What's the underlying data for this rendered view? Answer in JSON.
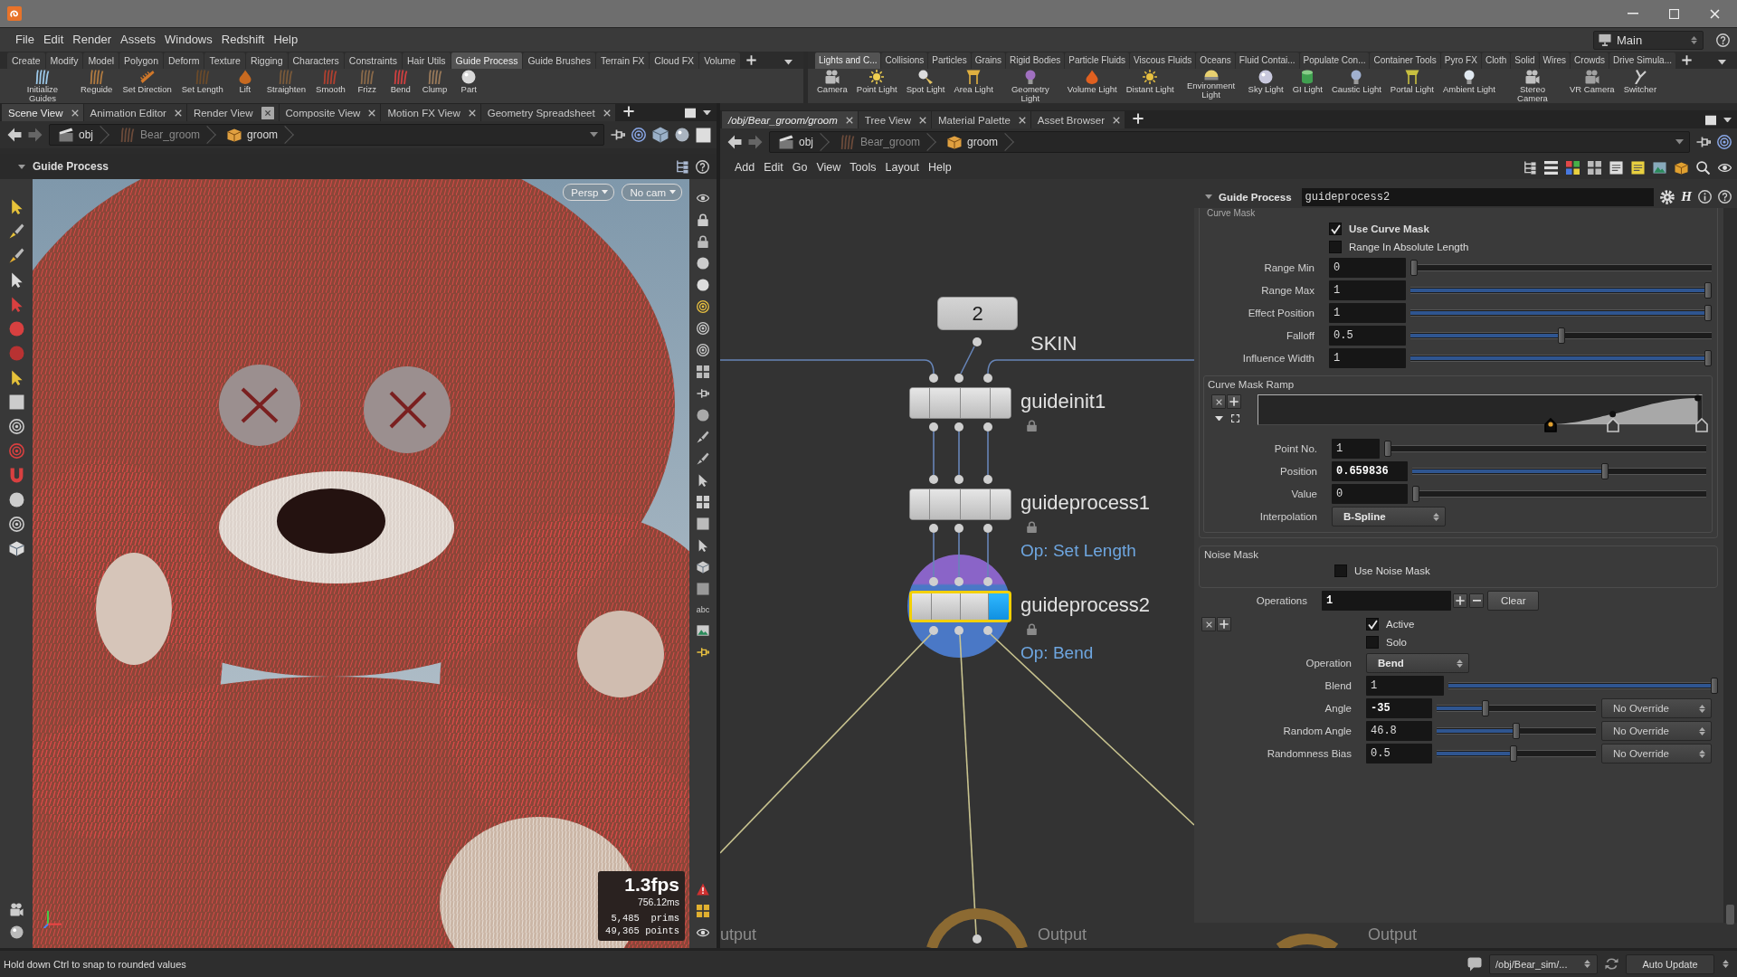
{
  "menu_bar": {
    "items": [
      "File",
      "Edit",
      "Render",
      "Assets",
      "Windows",
      "Redshift",
      "Help"
    ],
    "desktop": "Main"
  },
  "shelves": [
    {
      "tabs": [
        {
          "label": "Create",
          "selected": false
        },
        {
          "label": "Modify",
          "selected": false
        },
        {
          "label": "Model",
          "selected": false
        },
        {
          "label": "Polygon",
          "selected": false
        },
        {
          "label": "Deform",
          "selected": false
        },
        {
          "label": "Texture",
          "selected": false
        },
        {
          "label": "Rigging",
          "selected": false
        },
        {
          "label": "Characters",
          "selected": false
        },
        {
          "label": "Constraints",
          "selected": false
        },
        {
          "label": "Hair Utils",
          "selected": false
        },
        {
          "label": "Guide Process",
          "selected": true
        },
        {
          "label": "Guide Brushes",
          "selected": false
        },
        {
          "label": "Terrain FX",
          "selected": false
        },
        {
          "label": "Cloud FX",
          "selected": false
        },
        {
          "label": "Volume",
          "selected": false
        }
      ],
      "tools": [
        "Initialize Guides",
        "Reguide",
        "Set Direction",
        "Set Length",
        "Lift",
        "Straighten",
        "Smooth",
        "Frizz",
        "Bend",
        "Clump",
        "Part"
      ]
    },
    {
      "tabs": [
        {
          "label": "Lights and C...",
          "selected": true
        },
        {
          "label": "Collisions",
          "selected": false
        },
        {
          "label": "Particles",
          "selected": false
        },
        {
          "label": "Grains",
          "selected": false
        },
        {
          "label": "Rigid Bodies",
          "selected": false
        },
        {
          "label": "Particle Fluids",
          "selected": false
        },
        {
          "label": "Viscous Fluids",
          "selected": false
        },
        {
          "label": "Oceans",
          "selected": false
        },
        {
          "label": "Fluid Contai...",
          "selected": false
        },
        {
          "label": "Populate Con...",
          "selected": false
        },
        {
          "label": "Container Tools",
          "selected": false
        },
        {
          "label": "Pyro FX",
          "selected": false
        },
        {
          "label": "Cloth",
          "selected": false
        },
        {
          "label": "Solid",
          "selected": false
        },
        {
          "label": "Wires",
          "selected": false
        },
        {
          "label": "Crowds",
          "selected": false
        },
        {
          "label": "Drive Simula...",
          "selected": false
        }
      ],
      "tools": [
        "Camera",
        "Point Light",
        "Spot Light",
        "Area Light",
        "Geometry Light",
        "Volume Light",
        "Distant Light",
        "Environment Light",
        "Sky Light",
        "GI Light",
        "Caustic Light",
        "Portal Light",
        "Ambient Light",
        "Stereo Camera",
        "VR Camera",
        "Switcher"
      ]
    }
  ],
  "scene_view": {
    "tabs": [
      {
        "label": "Scene View",
        "selected": true,
        "close_hover": false
      },
      {
        "label": "Animation Editor",
        "selected": false,
        "close_hover": false
      },
      {
        "label": "Render View",
        "selected": false,
        "close_hover": true
      },
      {
        "label": "Composite View",
        "selected": false,
        "close_hover": false
      },
      {
        "label": "Motion FX View",
        "selected": false,
        "close_hover": false
      },
      {
        "label": "Geometry Spreadsheet",
        "selected": false,
        "close_hover": false
      }
    ],
    "path": [
      {
        "label": "obj",
        "dimmed": false
      },
      {
        "label": "Bear_groom",
        "dimmed": true
      },
      {
        "label": "groom",
        "dimmed": false
      }
    ],
    "header": "Guide Process",
    "camera_menus": [
      "Persp",
      "No cam"
    ],
    "fps": "1.3fps",
    "frame_time": "756.12ms",
    "stats": [
      "5,485  prims",
      "49,365 points"
    ],
    "toolbar_label": "abc"
  },
  "network_view": {
    "tabs": [
      {
        "label": "/obj/Bear_groom/groom",
        "selected": true,
        "close_hover": false
      },
      {
        "label": "Tree View",
        "selected": false,
        "close_hover": false
      },
      {
        "label": "Material Palette",
        "selected": false,
        "close_hover": false
      },
      {
        "label": "Asset Browser",
        "selected": false,
        "close_hover": false
      }
    ],
    "path": [
      {
        "label": "obj",
        "dimmed": false
      },
      {
        "label": "Bear_groom",
        "dimmed": true
      },
      {
        "label": "groom",
        "dimmed": false
      }
    ],
    "menu": [
      "Add",
      "Edit",
      "Go",
      "View",
      "Tools",
      "Layout",
      "Help"
    ],
    "nodes": [
      {
        "kind": "tag",
        "label": "2",
        "name": "SKIN",
        "selected": false
      },
      {
        "kind": "node",
        "name": "guideinit1",
        "locked": true,
        "selected": false,
        "display": false
      },
      {
        "kind": "node",
        "name": "guideprocess1",
        "comment": "Op: Set Length",
        "locked": true,
        "selected": false,
        "display": false
      },
      {
        "kind": "node",
        "name": "guideprocess2",
        "comment": "Op: Bend",
        "locked": true,
        "selected": true,
        "display": true
      },
      {
        "kind": "output",
        "name": "utput",
        "selected": false
      },
      {
        "kind": "output",
        "name": "Output",
        "selected": false
      },
      {
        "kind": "output",
        "name": "Output",
        "selected": false
      }
    ]
  },
  "parameters": {
    "title": "Guide Process",
    "node_name": "guideprocess2",
    "asset_menu": "H",
    "folder_label": "Curve Mask",
    "curve_mask": [
      {
        "kind": "checkbox",
        "label": "Use Curve Mask",
        "checked": true,
        "modified": true
      },
      {
        "kind": "checkbox",
        "label": "Range In Absolute Length",
        "checked": false,
        "modified": false
      },
      {
        "kind": "slider",
        "label": "Range Min",
        "value": "0",
        "level": 0,
        "modified": false
      },
      {
        "kind": "slider",
        "label": "Range Max",
        "value": "1",
        "level": 1,
        "modified": false
      },
      {
        "kind": "slider",
        "label": "Effect Position",
        "value": "1",
        "level": 1,
        "modified": false
      },
      {
        "kind": "slider",
        "label": "Falloff",
        "value": "0.5",
        "level": 0.5,
        "modified": false
      },
      {
        "kind": "slider",
        "label": "Influence Width",
        "value": "1",
        "level": 1,
        "modified": false
      }
    ],
    "ramp": {
      "label": "Curve Mask Ramp",
      "points": [
        {
          "level": 0.66,
          "selected": true
        },
        {
          "level": 0.8,
          "selected": false
        },
        {
          "level": 1,
          "selected": false
        }
      ],
      "rows": [
        {
          "kind": "int_slider",
          "label": "Point No.",
          "value": "1",
          "level": 0,
          "modified": false
        },
        {
          "kind": "slider",
          "label": "Position",
          "value": "0.659836",
          "level": 0.66,
          "modified": true
        },
        {
          "kind": "slider",
          "label": "Value",
          "value": "0",
          "level": 0,
          "modified": false
        },
        {
          "kind": "menu",
          "label": "Interpolation",
          "value": "B-Spline"
        }
      ]
    },
    "noise_mask": {
      "label": "Noise Mask",
      "rows": [
        {
          "kind": "checkbox",
          "label": "Use Noise Mask",
          "checked": false,
          "modified": false
        }
      ]
    },
    "operations": {
      "label": "Operations",
      "value": "1",
      "modified": true,
      "clear": "Clear",
      "rows": [
        {
          "kind": "checkbox",
          "label": "Active",
          "checked": true,
          "modified": false
        },
        {
          "kind": "checkbox",
          "label": "Solo",
          "checked": false,
          "modified": false
        },
        {
          "kind": "menu",
          "label": "Operation",
          "value": "Bend"
        },
        {
          "kind": "slider",
          "label": "Blend",
          "value": "1",
          "level": 1,
          "modified": false
        },
        {
          "kind": "override_slider",
          "label": "Angle",
          "value": "-35",
          "level": 0.3,
          "modified": true,
          "override": "No Override"
        },
        {
          "kind": "override_slider",
          "label": "Random Angle",
          "value": "46.8",
          "level": 0.5,
          "modified": false,
          "override": "No Override"
        },
        {
          "kind": "override_slider",
          "label": "Randomness Bias",
          "value": "0.5",
          "level": 0.48,
          "modified": false,
          "override": "No Override"
        }
      ]
    }
  },
  "status_bar": {
    "message": "Hold down Ctrl to snap to rounded values",
    "path": "/obj/Bear_sim/...",
    "update_mode": "Auto Update"
  }
}
